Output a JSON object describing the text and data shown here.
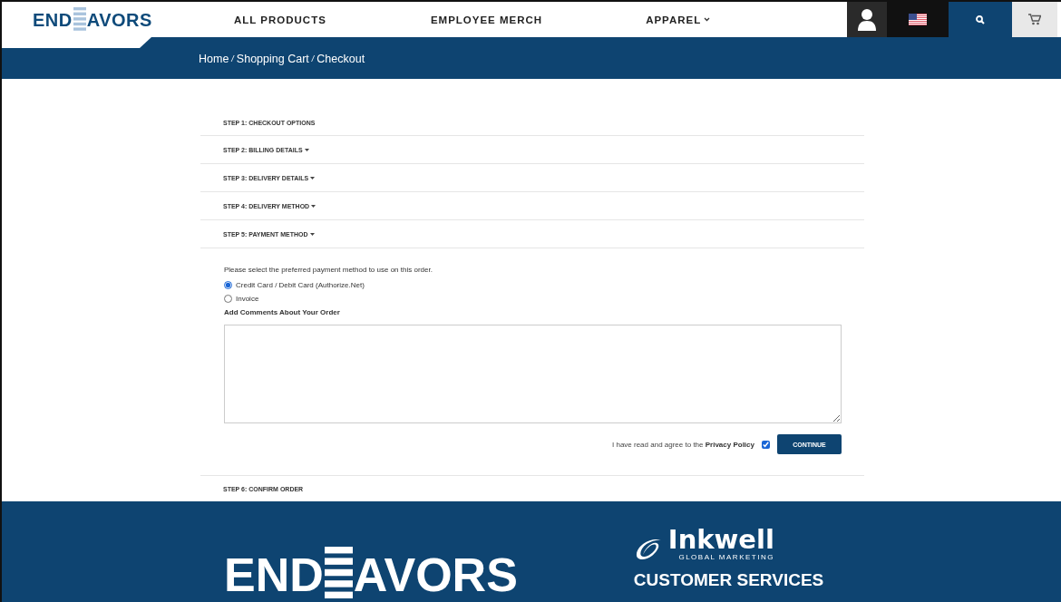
{
  "header": {
    "logo": {
      "before": "END",
      "after": "AVORS"
    },
    "nav": [
      {
        "label": "ALL PRODUCTS",
        "dropdown": false
      },
      {
        "label": "EMPLOYEE MERCH",
        "dropdown": false
      },
      {
        "label": "APPAREL",
        "dropdown": true
      }
    ]
  },
  "breadcrumb": {
    "separator": "/",
    "items": [
      "Home",
      "Shopping Cart",
      "Checkout"
    ]
  },
  "steps": [
    {
      "label": "STEP 1: CHECKOUT OPTIONS",
      "collapsible": false
    },
    {
      "label": "STEP 2: BILLING DETAILS",
      "collapsible": true
    },
    {
      "label": "STEP 3: DELIVERY DETAILS",
      "collapsible": true
    },
    {
      "label": "STEP 4: DELIVERY METHOD",
      "collapsible": true
    },
    {
      "label": "STEP 5: PAYMENT METHOD",
      "collapsible": true
    }
  ],
  "payment": {
    "intro": "Please select the preferred payment method to use on this order.",
    "options": [
      {
        "label": "Credit Card / Debit Card (Authorize.Net)",
        "selected": true
      },
      {
        "label": "Invoice",
        "selected": false
      }
    ],
    "comments_label": "Add Comments About Your Order",
    "agree": {
      "text": "I have read and agree to the ",
      "link": "Privacy Policy",
      "checked": true
    },
    "button": "CONTINUE"
  },
  "final_step": {
    "label": "STEP 6: CONFIRM ORDER"
  },
  "footer": {
    "logo": {
      "before": "END",
      "after": "AVORS"
    },
    "partner": {
      "name": "Inkwell",
      "tagline": "GLOBAL MARKETING"
    },
    "heading": "CUSTOMER SERVICES"
  }
}
